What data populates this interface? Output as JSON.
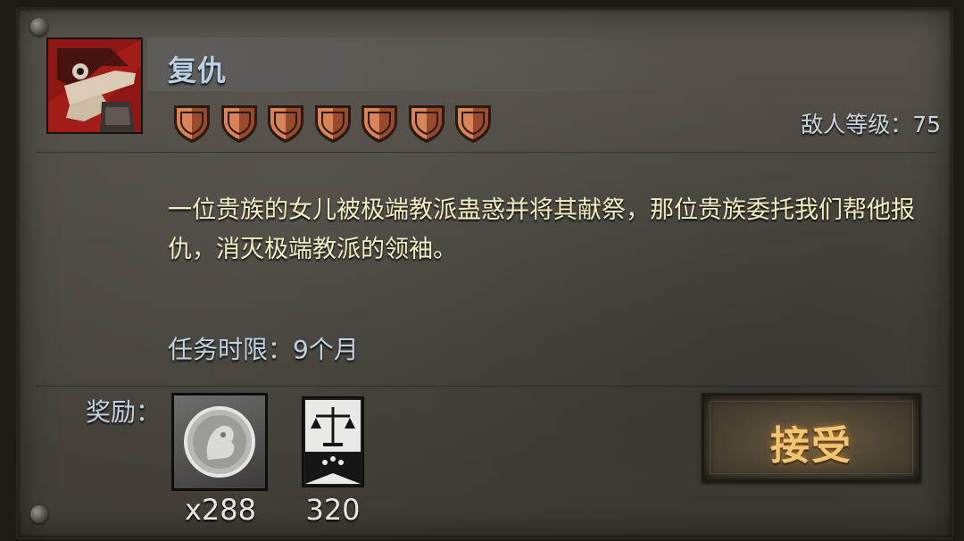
{
  "quest": {
    "title": "复仇",
    "icon": "hero-portrait-icon",
    "difficulty_shields": 7,
    "enemy_level_text": "敌人等级：75",
    "description": "一位贵族的女儿被极端教派蛊惑并将其献祭，那位贵族委托我们帮他报仇，消灭极端教派的领袖。",
    "time_limit_text": "任务时限：9个月"
  },
  "rewards": {
    "label": "奖励：",
    "items": [
      {
        "icon": "silver-coin-icon",
        "count": "x288"
      },
      {
        "icon": "justice-banner-icon",
        "count": "320"
      }
    ]
  },
  "actions": {
    "accept_label": "接受"
  },
  "colors": {
    "title": "#b9d0e6",
    "description": "#f1ecc2",
    "accept": "#f2c574",
    "shield": "#b5603a"
  }
}
